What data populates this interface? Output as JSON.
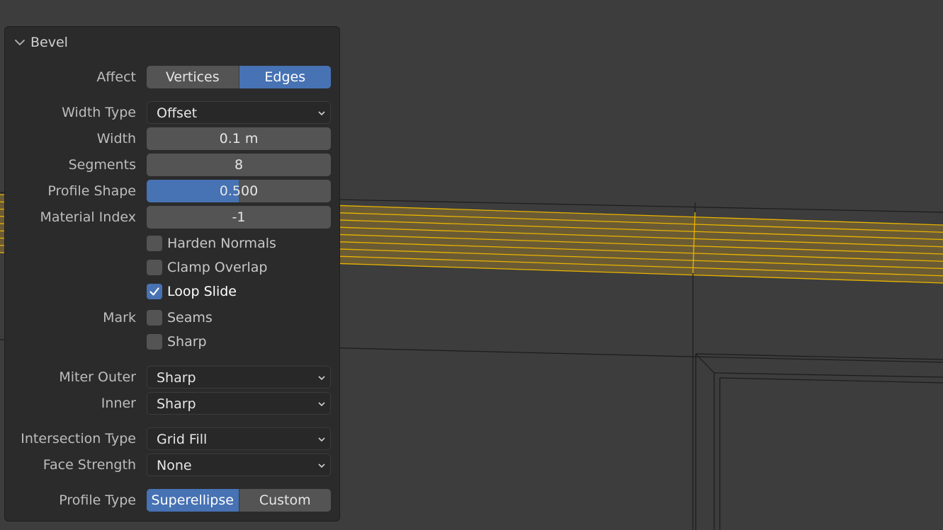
{
  "panel": {
    "title": "Bevel",
    "accent_color": "#4772b3",
    "affect": {
      "label": "Affect",
      "options": [
        "Vertices",
        "Edges"
      ],
      "selected": "Edges"
    },
    "width_type": {
      "label": "Width Type",
      "value": "Offset"
    },
    "width": {
      "label": "Width",
      "value": "0.1 m"
    },
    "segments": {
      "label": "Segments",
      "value": "8"
    },
    "profile_shape": {
      "label": "Profile Shape",
      "value": "0.500",
      "fraction": 0.5
    },
    "material_index": {
      "label": "Material Index",
      "value": "-1"
    },
    "harden_normals": {
      "label": "Harden Normals",
      "checked": false
    },
    "clamp_overlap": {
      "label": "Clamp Overlap",
      "checked": false
    },
    "loop_slide": {
      "label": "Loop Slide",
      "checked": true
    },
    "mark": {
      "label": "Mark",
      "seams": {
        "label": "Seams",
        "checked": false
      },
      "sharp": {
        "label": "Sharp",
        "checked": false
      }
    },
    "miter_outer": {
      "label": "Miter Outer",
      "value": "Sharp"
    },
    "inner": {
      "label": "Inner",
      "value": "Sharp"
    },
    "intersection_type": {
      "label": "Intersection Type",
      "value": "Grid Fill"
    },
    "face_strength": {
      "label": "Face Strength",
      "value": "None"
    },
    "profile_type": {
      "label": "Profile Type",
      "options": [
        "Superellipse",
        "Custom"
      ],
      "selected": "Superellipse"
    }
  },
  "icons": {
    "collapse": "chevron-down-icon",
    "dropdown": "chevron-down-icon",
    "check": "checkmark-icon"
  },
  "viewport": {
    "background_color": "#3d3d3d",
    "selection_color": "#e8b400",
    "selected_face_color": "#7a6531"
  }
}
